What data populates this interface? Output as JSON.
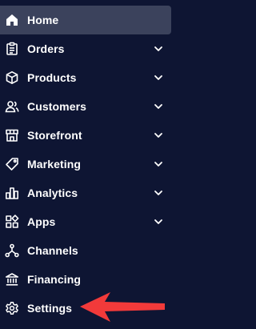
{
  "nav": {
    "items": [
      {
        "label": "Home",
        "icon": "home-icon",
        "active": true
      },
      {
        "label": "Orders",
        "icon": "orders-icon",
        "expandable": true
      },
      {
        "label": "Products",
        "icon": "box-icon",
        "expandable": true
      },
      {
        "label": "Customers",
        "icon": "users-icon",
        "expandable": true
      },
      {
        "label": "Storefront",
        "icon": "storefront-icon",
        "expandable": true
      },
      {
        "label": "Marketing",
        "icon": "tag-icon",
        "expandable": true
      },
      {
        "label": "Analytics",
        "icon": "bar-chart-icon",
        "expandable": true
      },
      {
        "label": "Apps",
        "icon": "apps-icon",
        "expandable": true
      },
      {
        "label": "Channels",
        "icon": "channels-icon"
      },
      {
        "label": "Financing",
        "icon": "bank-icon"
      },
      {
        "label": "Settings",
        "icon": "gear-icon"
      }
    ]
  },
  "colors": {
    "background": "#0e1533",
    "active_background": "#3b425c",
    "text": "#ffffff",
    "annotation_arrow": "#f23a3a"
  }
}
